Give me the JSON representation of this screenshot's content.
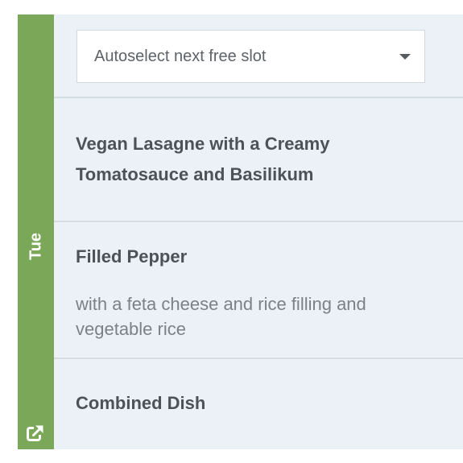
{
  "day": {
    "label": "Tue",
    "accent_color": "#7aa858",
    "icon": "external-link-icon"
  },
  "slot_select": {
    "value": "Autoselect next free slot",
    "icon": "chevron-down-icon"
  },
  "dishes": [
    {
      "title": "Vegan Lasagne with a Creamy Tomatosauce and Basilikum",
      "description": ""
    },
    {
      "title": "Filled Pepper",
      "description": "with a feta cheese and rice filling and vegetable rice"
    },
    {
      "title": "Combined Dish",
      "description": ""
    }
  ]
}
